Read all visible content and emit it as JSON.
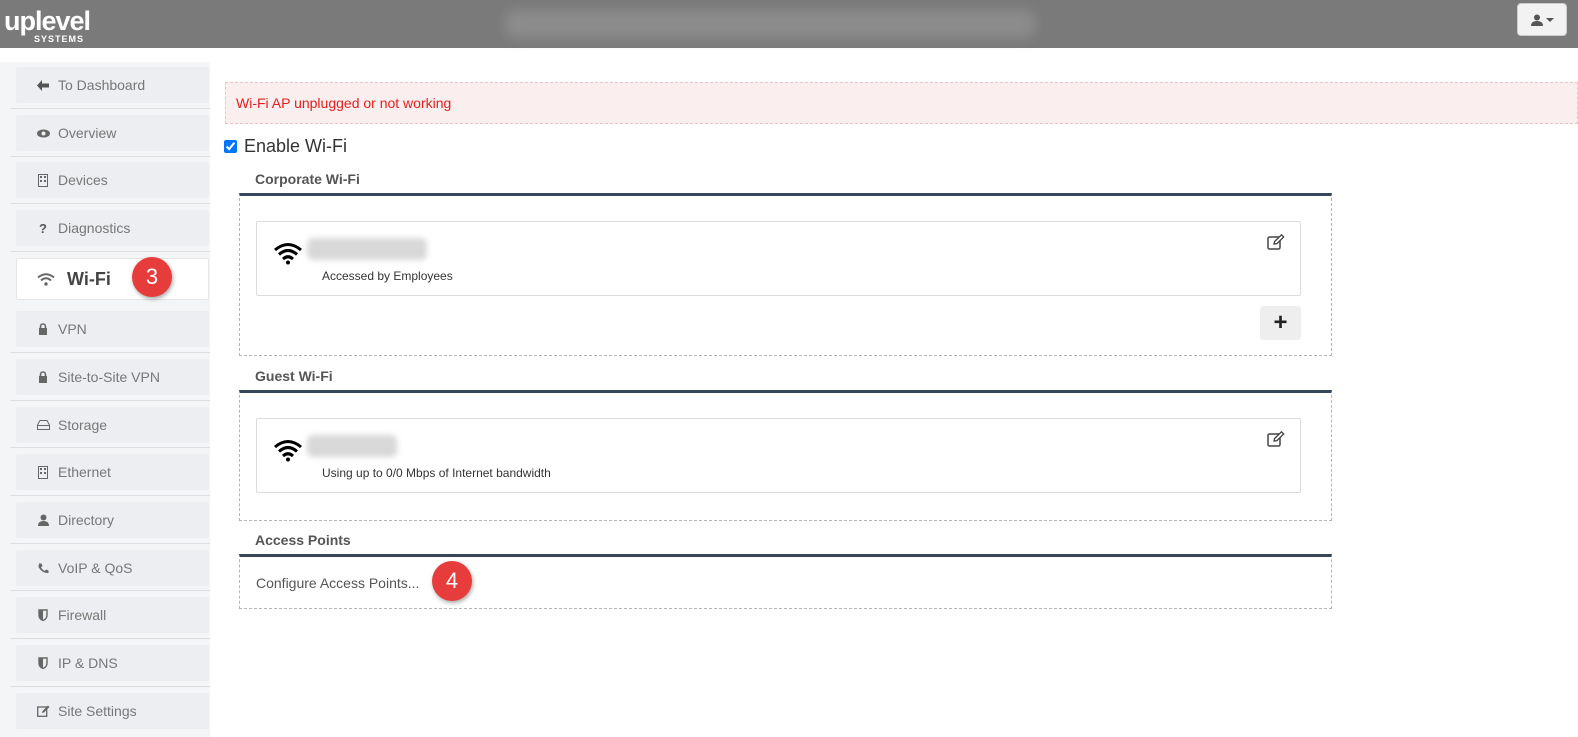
{
  "brand": {
    "logo_text": "uplevel",
    "logo_subtext": "SYSTEMS"
  },
  "user_menu": {
    "icon": "user-icon",
    "caret": "caret-down-icon"
  },
  "sidebar": {
    "items": [
      {
        "label": "To Dashboard",
        "icon": "arrow-left-icon"
      },
      {
        "label": "Overview",
        "icon": "eye-icon"
      },
      {
        "label": "Devices",
        "icon": "building-icon"
      },
      {
        "label": "Diagnostics",
        "icon": "question-icon"
      },
      {
        "label": "Wi-Fi",
        "icon": "wifi-icon",
        "active": true
      },
      {
        "label": "VPN",
        "icon": "lock-icon"
      },
      {
        "label": "Site-to-Site VPN",
        "icon": "lock-icon"
      },
      {
        "label": "Storage",
        "icon": "drive-icon"
      },
      {
        "label": "Ethernet",
        "icon": "building-icon"
      },
      {
        "label": "Directory",
        "icon": "user-icon"
      },
      {
        "label": "VoIP & QoS",
        "icon": "phone-icon"
      },
      {
        "label": "Firewall",
        "icon": "shield-icon"
      },
      {
        "label": "IP & DNS",
        "icon": "shield-icon"
      },
      {
        "label": "Site Settings",
        "icon": "edit-icon"
      }
    ]
  },
  "annotations": {
    "step3": "3",
    "step4": "4"
  },
  "alert": {
    "text": "Wi-Fi AP unplugged or not working",
    "color": "#e02020"
  },
  "enable_wifi": {
    "label": "Enable Wi-Fi",
    "checked": true
  },
  "corporate": {
    "title": "Corporate Wi-Fi",
    "network": {
      "description": "Accessed by Employees"
    },
    "add_label": "+"
  },
  "guest": {
    "title": "Guest Wi-Fi",
    "network": {
      "description": "Using up to 0/0 Mbps of Internet bandwidth"
    }
  },
  "access_points": {
    "title": "Access Points",
    "configure_label": "Configure Access Points..."
  },
  "colors": {
    "topbar": "#7a7a7a",
    "panel_border": "#37475a",
    "badge": "#e63c3c"
  }
}
